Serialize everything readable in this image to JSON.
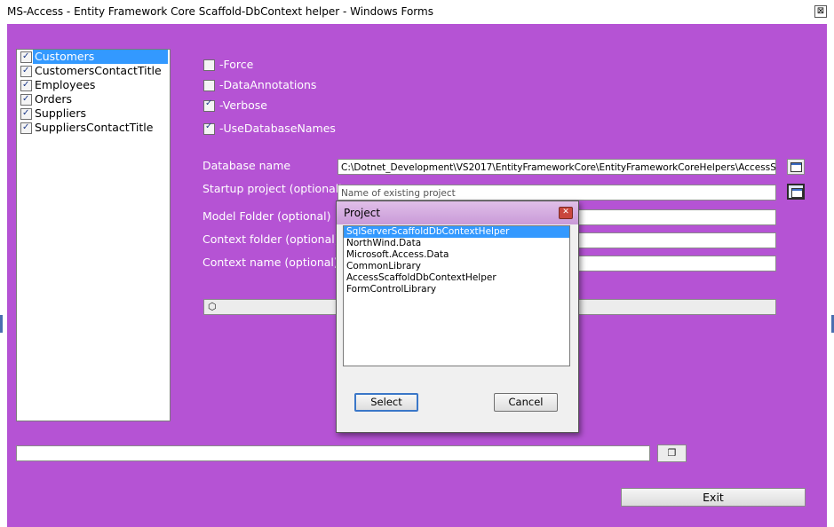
{
  "window": {
    "title": "MS-Access - Entity Framework Core Scaffold-DbContext helper - Windows Forms",
    "close_glyph": "⊠"
  },
  "tables": {
    "items": [
      {
        "label": "Customers",
        "checked": true,
        "selected": true
      },
      {
        "label": "CustomersContactTitle",
        "checked": true,
        "selected": false
      },
      {
        "label": "Employees",
        "checked": true,
        "selected": false
      },
      {
        "label": "Orders",
        "checked": true,
        "selected": false
      },
      {
        "label": "Suppliers",
        "checked": true,
        "selected": false
      },
      {
        "label": "SuppliersContactTitle",
        "checked": true,
        "selected": false
      }
    ]
  },
  "options": {
    "force": {
      "label": "-Force",
      "checked": false
    },
    "data_annotations": {
      "label": "-DataAnnotations",
      "checked": false
    },
    "verbose": {
      "label": "-Verbose",
      "checked": true
    },
    "use_database_names": {
      "label": "-UseDatabaseNames",
      "checked": true
    }
  },
  "fields": {
    "database_name": {
      "label": "Database name",
      "value": "C:\\Dotnet_Development\\VS2017\\EntityFrameworkCore\\EntityFrameworkCoreHelpers\\AccessScaffoldD"
    },
    "startup_project": {
      "label": "Startup project (optional)",
      "placeholder": "Name of existing project"
    },
    "model_folder": {
      "label": "Model Folder (optional)",
      "value": ""
    },
    "context_folder": {
      "label": "Context folder (optional)",
      "value": ""
    },
    "context_name": {
      "label": "Context name (optional)",
      "value": ""
    }
  },
  "footer": {
    "status_text": "",
    "exit_label": "Exit"
  },
  "dialog": {
    "title": "Project",
    "close_glyph": "✕",
    "items": [
      {
        "label": "SqlServerScaffoldDbContextHelper",
        "selected": true
      },
      {
        "label": "NorthWind.Data",
        "selected": false
      },
      {
        "label": "Microsoft.Access.Data",
        "selected": false
      },
      {
        "label": "CommonLibrary",
        "selected": false
      },
      {
        "label": "AccessScaffoldDbContextHelper",
        "selected": false
      },
      {
        "label": "FormControlLibrary",
        "selected": false
      }
    ],
    "select_label": "Select",
    "cancel_label": "Cancel"
  },
  "colors": {
    "client_background": "#b553d4",
    "selection": "#3399ff",
    "dialog_title": "#c99ad8"
  },
  "icons": {
    "browse": "folder-browse-icon",
    "run": "cube-run-icon",
    "copy": "copy-icon"
  }
}
